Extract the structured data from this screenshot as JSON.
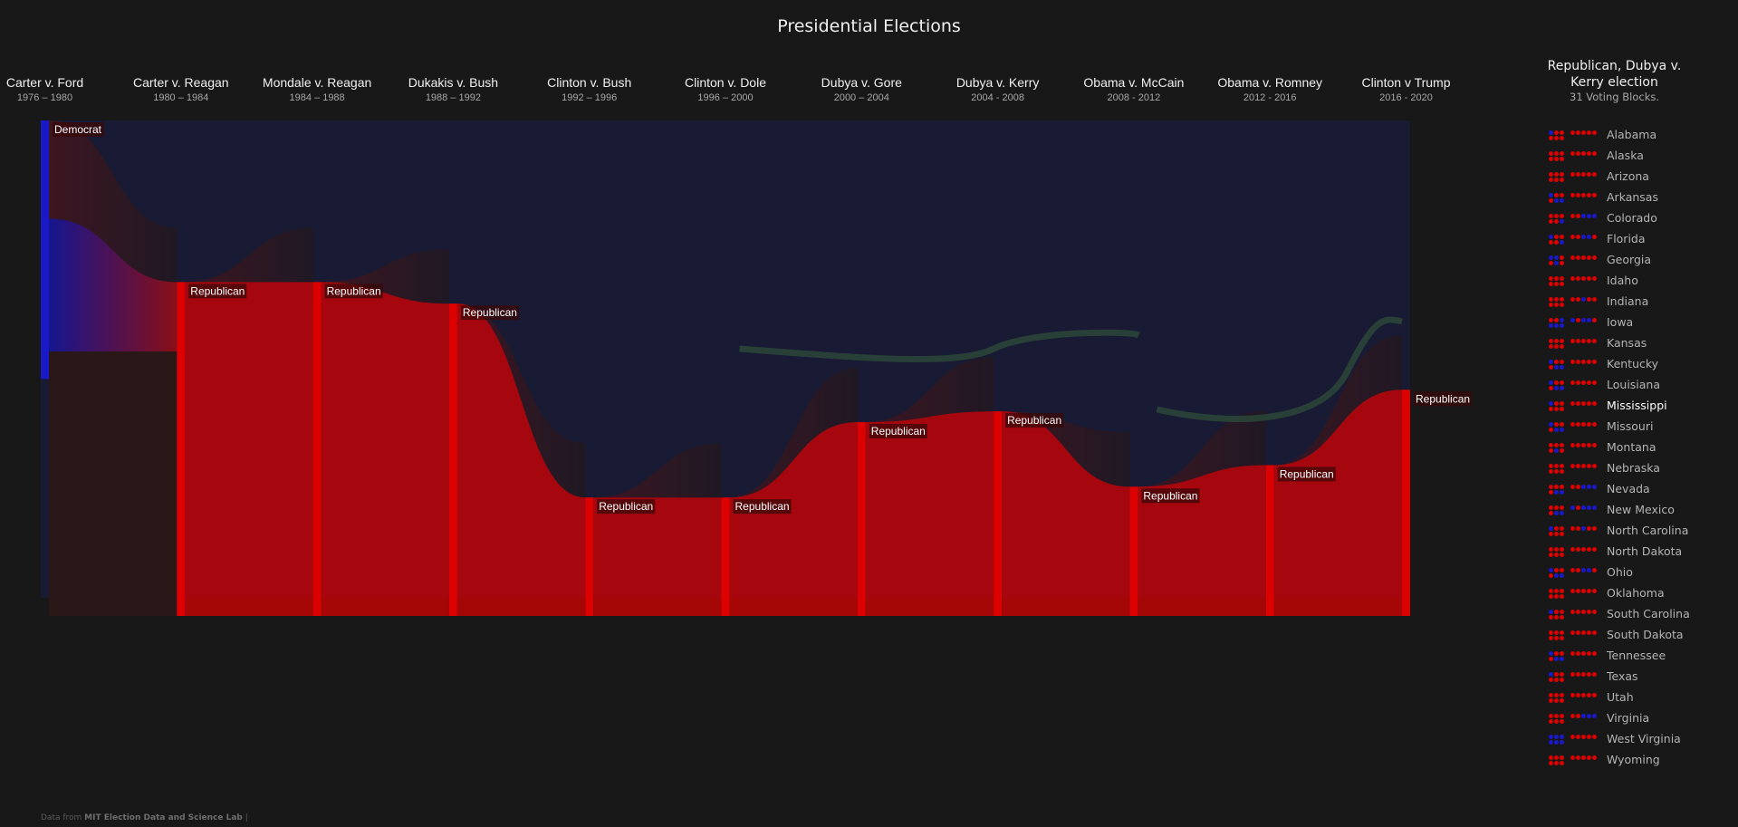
{
  "title": "Presidential Elections",
  "colors": {
    "democrat": "#1919c8",
    "republican": "#dd0000",
    "swing": "#2c4a3a",
    "bg": "#181818"
  },
  "chart_data": {
    "type": "sankey",
    "title": "Presidential Elections",
    "columns": [
      {
        "name": "Carter v. Ford",
        "years": "1976 – 1980",
        "nodes": [
          {
            "party": "Democrat",
            "label": "Democrat",
            "states": 24
          }
        ]
      },
      {
        "name": "Carter v. Reagan",
        "years": "1980 – 1984",
        "nodes": [
          {
            "party": "Republican",
            "label": "Republican",
            "states": 31
          }
        ]
      },
      {
        "name": "Mondale v. Reagan",
        "years": "1984 – 1988",
        "nodes": [
          {
            "party": "Republican",
            "label": "Republican",
            "states": 31
          }
        ]
      },
      {
        "name": "Dukakis v. Bush",
        "years": "1988 – 1992",
        "nodes": [
          {
            "party": "Republican",
            "label": "Republican",
            "states": 29
          }
        ]
      },
      {
        "name": "Clinton v. Bush",
        "years": "1992 – 1996",
        "nodes": [
          {
            "party": "Republican",
            "label": "Republican",
            "states": 11
          }
        ]
      },
      {
        "name": "Clinton v. Dole",
        "years": "1996 – 2000",
        "nodes": [
          {
            "party": "Republican",
            "label": "Republican",
            "states": 11
          }
        ]
      },
      {
        "name": "Dubya v. Gore",
        "years": "2000 – 2004",
        "nodes": [
          {
            "party": "Republican",
            "label": "Republican",
            "states": 18
          }
        ]
      },
      {
        "name": "Dubya v. Kerry",
        "years": "2004 - 2008",
        "nodes": [
          {
            "party": "Republican",
            "label": "Republican",
            "states": 19
          }
        ]
      },
      {
        "name": "Obama v. McCain",
        "years": "2008 - 2012",
        "nodes": [
          {
            "party": "Republican",
            "label": "Republican",
            "states": 12
          }
        ]
      },
      {
        "name": "Obama v. Romney",
        "years": "2012 - 2016",
        "nodes": [
          {
            "party": "Republican",
            "label": "Republican",
            "states": 14
          }
        ]
      },
      {
        "name": "Clinton v Trump",
        "years": "2016 - 2020",
        "nodes": [
          {
            "party": "Republican",
            "label": "Republican",
            "states": 21
          }
        ]
      }
    ]
  },
  "legend": {
    "title": "Republican, Dubya v. Kerry election",
    "subtitle": "31 Voting Blocks.",
    "states": [
      {
        "name": "Alabama",
        "pattern": "DRRRRRRRRRR",
        "active": false
      },
      {
        "name": "Alaska",
        "pattern": "RRRRRRRRRRR",
        "active": false
      },
      {
        "name": "Arizona",
        "pattern": "RRRRRRRRRRR",
        "active": false
      },
      {
        "name": "Arkansas",
        "pattern": "DRRRDDRRRRR",
        "active": false
      },
      {
        "name": "Colorado",
        "pattern": "RRRRRDRRDDD",
        "active": false
      },
      {
        "name": "Florida",
        "pattern": "DRRRRDRRDDR",
        "active": false
      },
      {
        "name": "Georgia",
        "pattern": "DDRRDRRRRRR",
        "active": false
      },
      {
        "name": "Idaho",
        "pattern": "RRRRRRRRRRR",
        "active": false
      },
      {
        "name": "Indiana",
        "pattern": "RRRRRRRRDRR",
        "active": false
      },
      {
        "name": "Iowa",
        "pattern": "RRDDDDDRDDR",
        "active": false
      },
      {
        "name": "Kansas",
        "pattern": "RRRRRRRRRRR",
        "active": false
      },
      {
        "name": "Kentucky",
        "pattern": "DRRRDDRRRRR",
        "active": false
      },
      {
        "name": "Louisiana",
        "pattern": "DRRRDDRRRRR",
        "active": false
      },
      {
        "name": "Mississippi",
        "pattern": "DRRRRRRRRRR",
        "active": true
      },
      {
        "name": "Missouri",
        "pattern": "DRRRDDRRRRR",
        "active": false
      },
      {
        "name": "Montana",
        "pattern": "RRRRDRRRRRR",
        "active": false
      },
      {
        "name": "Nebraska",
        "pattern": "RRRRRRRRRRR",
        "active": false
      },
      {
        "name": "Nevada",
        "pattern": "RRRRDDRRDDD",
        "active": false
      },
      {
        "name": "New Mexico",
        "pattern": "RRRRDDDRDDD",
        "active": false
      },
      {
        "name": "North Carolina",
        "pattern": "DRRRRRRRDRR",
        "active": false
      },
      {
        "name": "North Dakota",
        "pattern": "RRRRRRRRRRR",
        "active": false
      },
      {
        "name": "Ohio",
        "pattern": "DRRRDDRRDDR",
        "active": false
      },
      {
        "name": "Oklahoma",
        "pattern": "RRRRRRRRRRR",
        "active": false
      },
      {
        "name": "South Carolina",
        "pattern": "DRRRRRRRRRR",
        "active": false
      },
      {
        "name": "South Dakota",
        "pattern": "RRRRRRRRRRR",
        "active": false
      },
      {
        "name": "Tennessee",
        "pattern": "DRRRDDRRRRR",
        "active": false
      },
      {
        "name": "Texas",
        "pattern": "DRRRRRRRRRR",
        "active": false
      },
      {
        "name": "Utah",
        "pattern": "RRRRRRRRRRR",
        "active": false
      },
      {
        "name": "Virginia",
        "pattern": "RRRRRRRRDDD",
        "active": false
      },
      {
        "name": "West Virginia",
        "pattern": "DDDDDDRRRRR",
        "active": false
      },
      {
        "name": "Wyoming",
        "pattern": "RRRRRRRRRRR",
        "active": false
      }
    ]
  },
  "footer": {
    "prefix": "Data from",
    "source": "MIT Election Data and Science Lab",
    "suffix": "|"
  }
}
